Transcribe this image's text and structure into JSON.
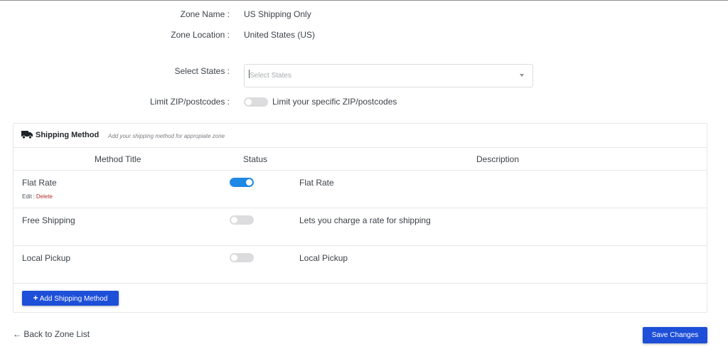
{
  "zone": {
    "name_label": "Zone Name :",
    "name_value": "US Shipping Only",
    "location_label": "Zone Location :",
    "location_value": "United States (US)",
    "states_label": "Select States :",
    "states_placeholder": "Select States",
    "zip_label": "Limit ZIP/postcodes :",
    "zip_toggle_text": "Limit your specific ZIP/postcodes",
    "zip_enabled": false
  },
  "shipping": {
    "title": "Shipping Method",
    "subtitle": "Add your shipping method for appropiate zone",
    "columns": [
      "Method Title",
      "Status",
      "Description"
    ],
    "methods": [
      {
        "title": "Flat Rate",
        "enabled": true,
        "description": "Flat Rate",
        "edit_label": "Edit",
        "delete_label": "Delete"
      },
      {
        "title": "Free Shipping",
        "enabled": false,
        "description": "Lets you charge a rate for shipping"
      },
      {
        "title": "Local Pickup",
        "enabled": false,
        "description": "Local Pickup"
      }
    ],
    "add_button": "Add Shipping Method"
  },
  "footer": {
    "back_link": "← Back to Zone List",
    "save_button": "Save Changes"
  },
  "colors": {
    "accent": "#1d4fd8",
    "toggle_on": "#1e88e5",
    "delete": "#b32d2e"
  },
  "icons": {
    "shipping_header": "truck-icon",
    "add": "plus-icon",
    "states_dropdown": "chevron-down-icon"
  }
}
